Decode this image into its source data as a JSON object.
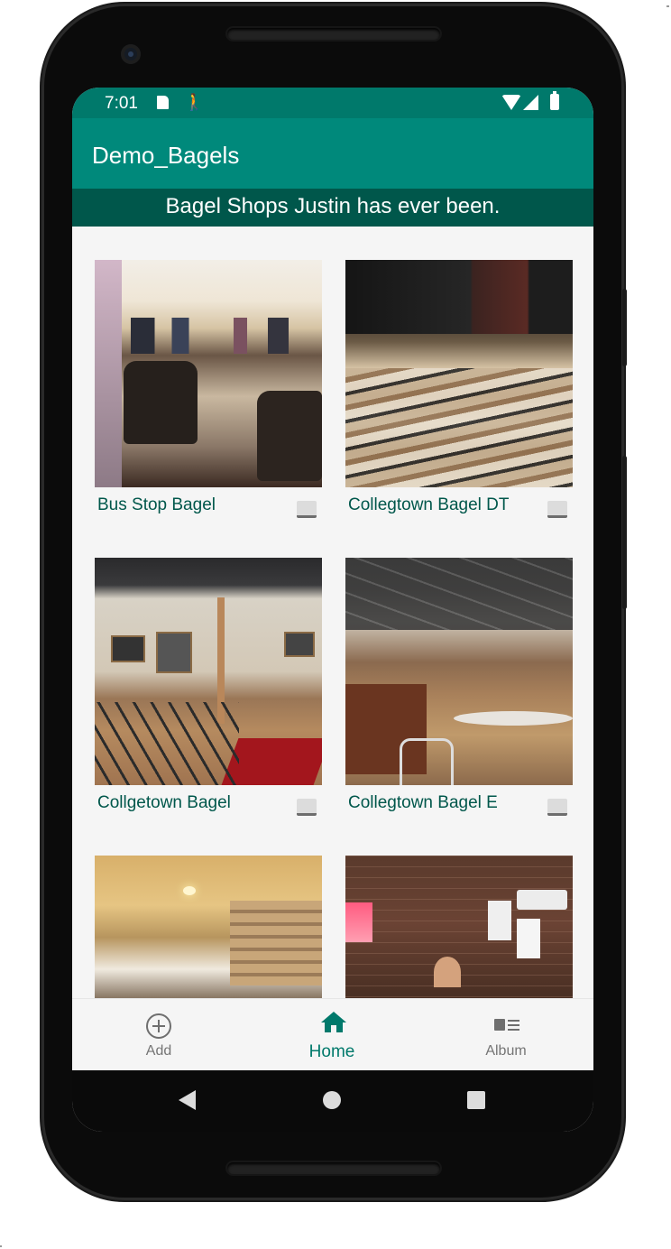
{
  "statusbar": {
    "time": "7:01",
    "icons": [
      "sd-card-icon",
      "walk-icon",
      "wifi-icon",
      "signal-icon",
      "battery-icon"
    ]
  },
  "appbar": {
    "title": "Demo_Bagels"
  },
  "subtitle": "Bagel Shops Justin has ever been.",
  "shops": [
    {
      "name": "Bus Stop Bagel",
      "checked": false
    },
    {
      "name": "Collegtown Bagel DT",
      "checked": false
    },
    {
      "name": "Collgetown Bagel",
      "checked": false
    },
    {
      "name": "Collegtown Bagel E",
      "checked": false
    },
    {
      "name": "",
      "checked": false
    },
    {
      "name": "",
      "checked": false
    }
  ],
  "bottom_nav": {
    "add": {
      "label": "Add",
      "icon": "add-circle-icon"
    },
    "home": {
      "label": "Home",
      "icon": "home-icon",
      "active": true
    },
    "album": {
      "label": "Album",
      "icon": "album-icon"
    }
  },
  "colors": {
    "statusbar": "#00796b",
    "appbar": "#00897b",
    "subtitle_bar": "#00574b",
    "accent": "#00796b"
  }
}
